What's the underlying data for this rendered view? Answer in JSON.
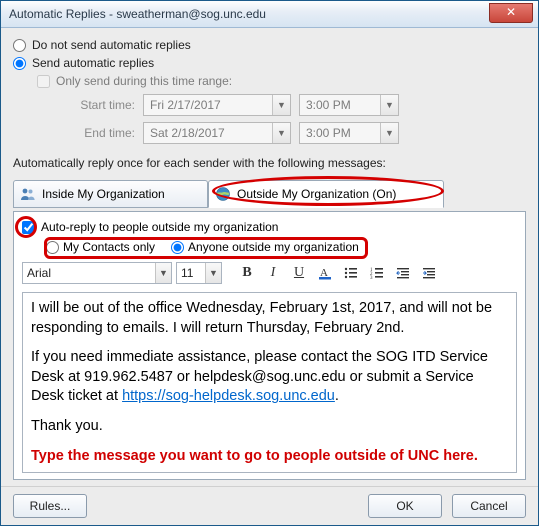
{
  "window": {
    "title": "Automatic Replies - sweatherman@sog.unc.edu",
    "close_label": "✕"
  },
  "options": {
    "dont_send_label": "Do not send automatic replies",
    "send_label": "Send automatic replies",
    "only_during_label": "Only send during this time range:"
  },
  "time": {
    "start_label": "Start time:",
    "end_label": "End time:",
    "start_date": "Fri 2/17/2017",
    "start_time": "3:00 PM",
    "end_date": "Sat 2/18/2017",
    "end_time": "3:00 PM"
  },
  "section_label": "Automatically reply once for each sender with the following messages:",
  "tabs": {
    "inside": "Inside My Organization",
    "outside": "Outside My Organization (On)"
  },
  "outside": {
    "auto_reply_label": "Auto-reply to people outside my organization",
    "contacts_only_label": "My Contacts only",
    "anyone_label": "Anyone outside my organization"
  },
  "toolbar": {
    "font": "Arial",
    "size": "11"
  },
  "message": {
    "p1": "I will be out of the office Wednesday, February 1st, 2017, and will not be responding to emails. I will return Thursday, February 2nd.",
    "p2a": "If you need immediate assistance, please contact the SOG ITD Service Desk at 919.962.5487 or helpdesk@sog.unc.edu or submit a Service Desk ticket at ",
    "p2_link_text": "https://sog-helpdesk.sog.unc.edu",
    "p2b": ".",
    "p3": "Thank you.",
    "hint": "Type the message you want to go to people outside of UNC here."
  },
  "footer": {
    "rules": "Rules...",
    "ok": "OK",
    "cancel": "Cancel"
  }
}
